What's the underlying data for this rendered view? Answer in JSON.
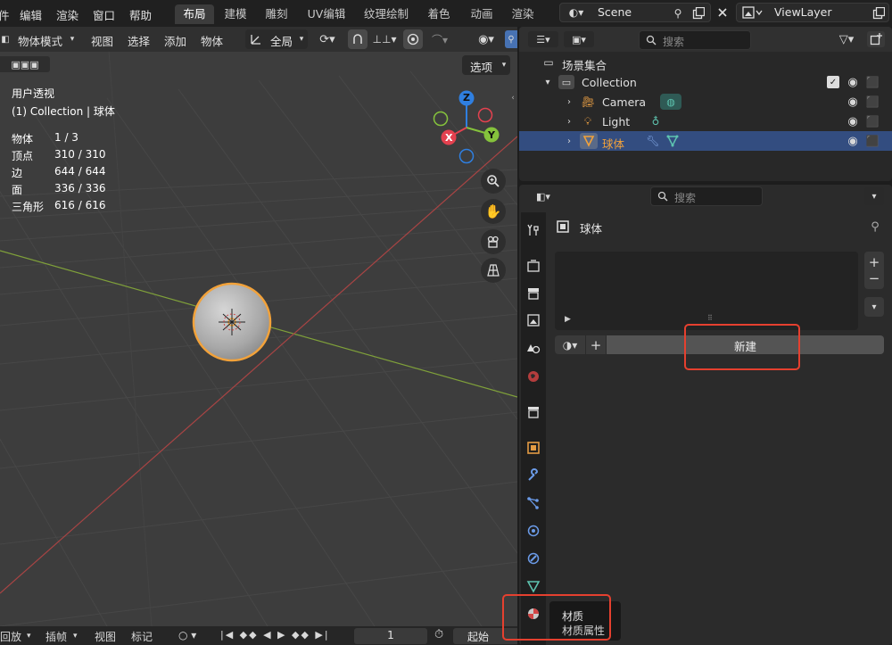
{
  "menu": {
    "edit": "编辑",
    "render": "渲染",
    "window": "窗口",
    "help": "帮助"
  },
  "workspaces": [
    "布局",
    "建模",
    "雕刻",
    "UV编辑",
    "纹理绘制",
    "着色",
    "动画",
    "渲染"
  ],
  "scene": {
    "name": "Scene"
  },
  "view_layer": {
    "name": "ViewLayer"
  },
  "viewport_header": {
    "mode": "物体模式",
    "view": "视图",
    "select": "选择",
    "add": "添加",
    "object": "物体",
    "transform_orientation": "全局",
    "options": "选项"
  },
  "viewport_overlay": {
    "view_name": "用户透视",
    "collection_info": "(1) Collection | 球体",
    "stats": [
      {
        "label": "物体",
        "value": "1 / 3"
      },
      {
        "label": "顶点",
        "value": "310 / 310"
      },
      {
        "label": "边",
        "value": "644 / 644"
      },
      {
        "label": "面",
        "value": "336 / 336"
      },
      {
        "label": "三角形",
        "value": "616 / 616"
      }
    ],
    "gizmo": {
      "z": "Z",
      "y": "Y",
      "x": "X"
    }
  },
  "timeline": {
    "playback": "回放",
    "keying": "插帧",
    "view": "视图",
    "marker": "标记",
    "current_frame": "1",
    "start_label": "起始"
  },
  "outliner": {
    "search_placeholder": "搜索",
    "scene_collection": "场景集合",
    "rows": [
      {
        "label": "Collection"
      },
      {
        "label": "Camera"
      },
      {
        "label": "Light"
      },
      {
        "label": "球体"
      }
    ]
  },
  "properties": {
    "search_placeholder": "搜索",
    "object_name": "球体",
    "new_button": "新建",
    "add_slot": "+",
    "remove_slot": "−"
  },
  "tooltip": {
    "title": "材质",
    "subtitle": "材质属性"
  },
  "colors": {
    "accent_blue": "#4772b3",
    "selected_row": "#334d80",
    "object_orange": "#e39b43",
    "highlight_red": "#e5402f",
    "axis_x": "#e3414f",
    "axis_y": "#85c23c",
    "axis_z": "#2f7fe0"
  }
}
